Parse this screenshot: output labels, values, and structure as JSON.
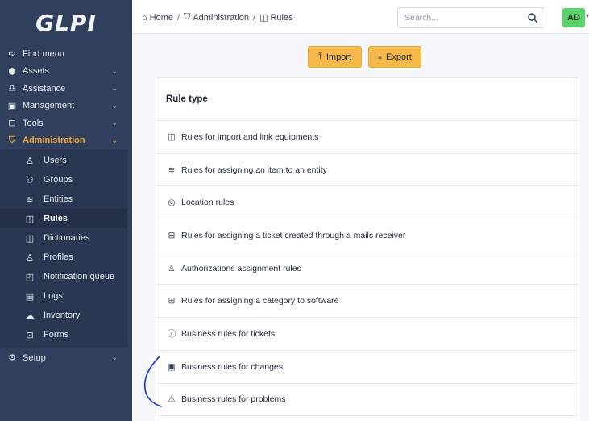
{
  "app": {
    "logo_text": "GLPI"
  },
  "sidebar": {
    "items": [
      {
        "label": "Find menu",
        "icon": "arrow-right-icon",
        "glyph": "➪",
        "chevron": ""
      },
      {
        "label": "Assets",
        "icon": "cube-icon",
        "glyph": "⬢",
        "chevron": "⌄"
      },
      {
        "label": "Assistance",
        "icon": "headset-icon",
        "glyph": "♎",
        "chevron": "⌄"
      },
      {
        "label": "Management",
        "icon": "wallet-icon",
        "glyph": "▣",
        "chevron": "⌄"
      },
      {
        "label": "Tools",
        "icon": "briefcase-icon",
        "glyph": "⊟",
        "chevron": "⌄"
      },
      {
        "label": "Administration",
        "icon": "shield-icon",
        "glyph": "⛉",
        "chevron": "⌄"
      }
    ],
    "submenu": [
      {
        "label": "Users",
        "icon": "user-icon",
        "glyph": "♙"
      },
      {
        "label": "Groups",
        "icon": "users-icon",
        "glyph": "⚇"
      },
      {
        "label": "Entities",
        "icon": "layers-icon",
        "glyph": "≋"
      },
      {
        "label": "Rules",
        "icon": "book-icon",
        "glyph": "◫"
      },
      {
        "label": "Dictionaries",
        "icon": "book-icon",
        "glyph": "◫"
      },
      {
        "label": "Profiles",
        "icon": "user-check-icon",
        "glyph": "♙"
      },
      {
        "label": "Notification queue",
        "icon": "notification-icon",
        "glyph": "◰"
      },
      {
        "label": "Logs",
        "icon": "news-icon",
        "glyph": "▤"
      },
      {
        "label": "Inventory",
        "icon": "cloud-upload-icon",
        "glyph": "☁"
      },
      {
        "label": "Forms",
        "icon": "forms-icon",
        "glyph": "⊡"
      }
    ],
    "setup": {
      "label": "Setup",
      "icon": "gear-icon",
      "glyph": "⚙",
      "chevron": "⌄"
    }
  },
  "breadcrumb": {
    "home": "Home",
    "admin": "Administration",
    "rules": "Rules",
    "separator": "/"
  },
  "search": {
    "placeholder": "Search..."
  },
  "user": {
    "initials": "AD",
    "avatar_color": "#5bd16a"
  },
  "toolbar": {
    "import_label": "Import",
    "export_label": "Export",
    "button_color": "#f6b94a"
  },
  "rules_card": {
    "title": "Rule type",
    "rows": [
      {
        "label": "Rules for import and link equipments",
        "icon": "book-icon",
        "glyph": "◫"
      },
      {
        "label": "Rules for assigning an item to an entity",
        "icon": "layers-icon",
        "glyph": "≋"
      },
      {
        "label": "Location rules",
        "icon": "map-pin-icon",
        "glyph": "◎"
      },
      {
        "label": "Rules for assigning a ticket created through a mails receiver",
        "icon": "inbox-icon",
        "glyph": "⊟"
      },
      {
        "label": "Authorizations assignment rules",
        "icon": "user-check-icon",
        "glyph": "♙"
      },
      {
        "label": "Rules for assigning a category to software",
        "icon": "apps-icon",
        "glyph": "⊞"
      },
      {
        "label": "Business rules for tickets",
        "icon": "alert-circle-icon",
        "glyph": "ⓘ"
      },
      {
        "label": "Business rules for changes",
        "icon": "clipboard-check-icon",
        "glyph": "▣"
      },
      {
        "label": "Business rules for problems",
        "icon": "alert-triangle-icon",
        "glyph": "⚠"
      }
    ]
  },
  "colors": {
    "sidebar_bg": "#2f3f5c",
    "active_menu": "#f5a83a",
    "annotation": "#1533d6"
  }
}
